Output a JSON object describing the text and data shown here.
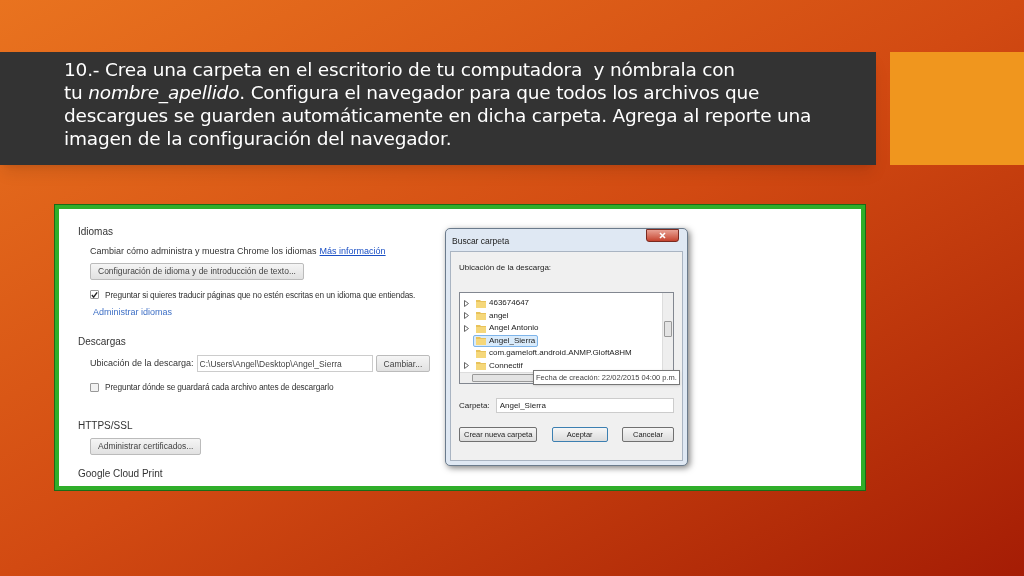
{
  "banner": {
    "text": "10.- Crea una carpeta en el escritorio de tu computadora  y nómbrala con\ntu *nombre_apellido*. Configura el navegador para que todos los archivos que descargues se guarden automáticamente en dicha carpeta. Agrega al reporte una imagen de la configuración del navegador."
  },
  "settings": {
    "languages": {
      "heading": "Idiomas",
      "description": "Cambiar cómo administra y muestra Chrome los idiomas",
      "link": "Más información",
      "button": "Configuración de idioma y de introducción de texto...",
      "checkbox": {
        "label": "Preguntar si quieres traducir páginas que no estén escritas en un idioma que entiendas.",
        "checked": true
      },
      "manage_link": "Administrar idiomas"
    },
    "downloads": {
      "heading": "Descargas",
      "location_label": "Ubicación de la descarga:",
      "location_value": "C:\\Users\\Angel\\Desktop\\Angel_Sierra",
      "change_button": "Cambiar...",
      "checkbox": {
        "label": "Preguntar dónde se guardará cada archivo antes de descargarlo",
        "checked": false
      }
    },
    "https": {
      "heading": "HTTPS/SSL",
      "button": "Administrar certificados..."
    },
    "cloud_print": {
      "heading": "Google Cloud Print"
    }
  },
  "dialog": {
    "title": "Buscar carpeta",
    "location_label": "Ubicación de la descarga:",
    "folders": [
      {
        "name": "463674647",
        "expandable": true,
        "selected": false
      },
      {
        "name": "angel",
        "expandable": true,
        "selected": false
      },
      {
        "name": "Angel Antonio",
        "expandable": true,
        "selected": false
      },
      {
        "name": "Angel_Sierra",
        "expandable": false,
        "selected": true
      },
      {
        "name": "com.gameloft.android.ANMP.GloftA8HM",
        "expandable": false,
        "selected": false
      },
      {
        "name": "Connectif",
        "expandable": true,
        "selected": false
      }
    ],
    "tooltip": "Fecha de creación: 22/02/2015 04:00 p.m.",
    "folder_label": "Carpeta:",
    "folder_value": "Angel_Sierra",
    "buttons": [
      {
        "label": "Crear nueva carpeta",
        "default": false
      },
      {
        "label": "Aceptar",
        "default": true
      },
      {
        "label": "Cancelar",
        "default": false
      }
    ]
  }
}
